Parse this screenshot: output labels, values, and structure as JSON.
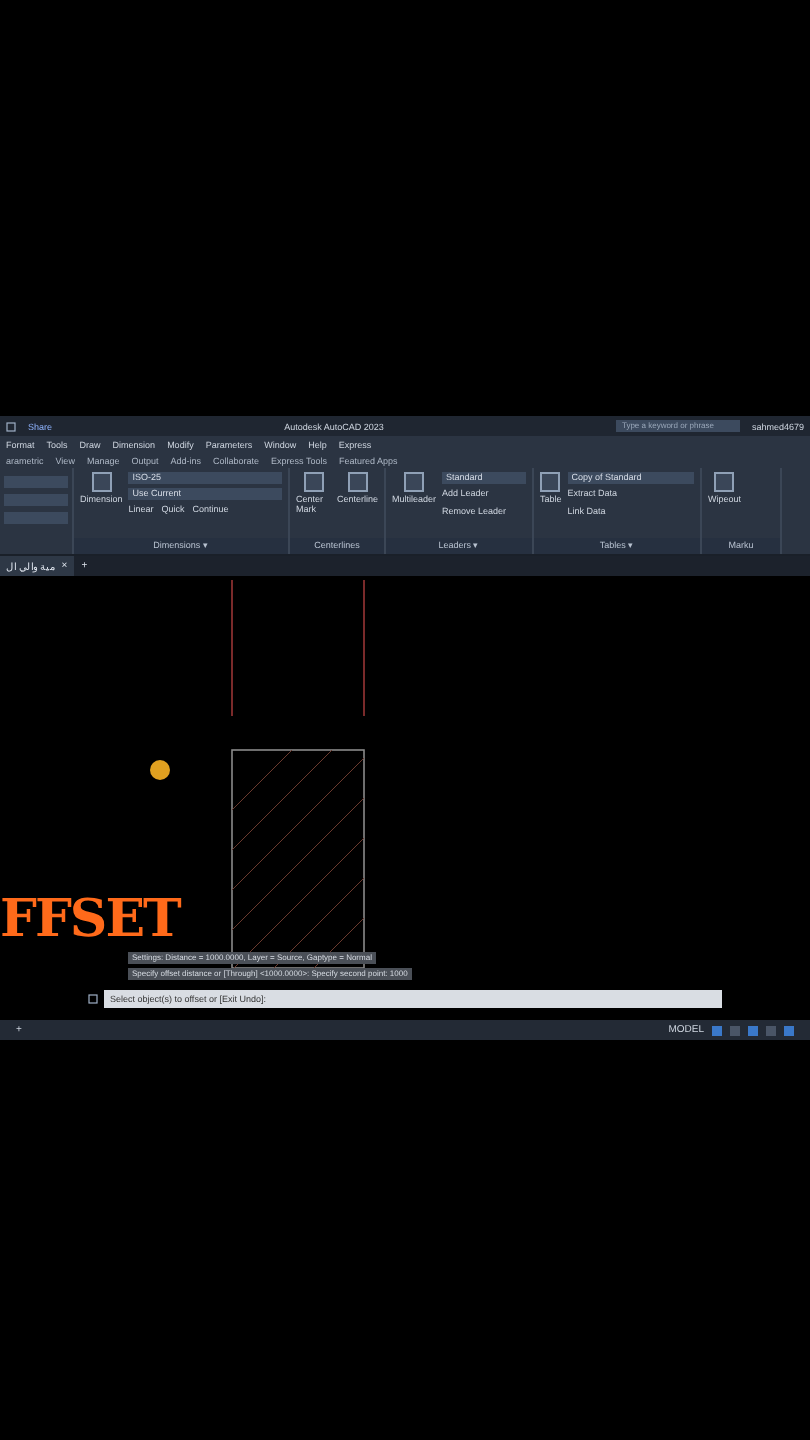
{
  "title_bar": {
    "share": "Share",
    "title": "Autodesk AutoCAD 2023",
    "search": {
      "placeholder": "Type a keyword or phrase"
    },
    "user": "sahmed4679"
  },
  "menu": [
    "Format",
    "Tools",
    "Draw",
    "Dimension",
    "Modify",
    "Parameters",
    "Window",
    "Help",
    "Express"
  ],
  "ribbon_tabs": [
    {
      "label": "arametric",
      "selected": false
    },
    {
      "label": "View",
      "selected": false
    },
    {
      "label": "Manage",
      "selected": false
    },
    {
      "label": "Output",
      "selected": false
    },
    {
      "label": "Add-ins",
      "selected": false
    },
    {
      "label": "Collaborate",
      "selected": false
    },
    {
      "label": "Express Tools",
      "selected": false
    },
    {
      "label": "Featured Apps",
      "selected": false
    }
  ],
  "panels": [
    {
      "kind": "dimensions",
      "title": "Dimensions ▾",
      "big": "Dimension",
      "style": "ISO-25",
      "layer": "Use Current",
      "tools": [
        "Linear",
        "Quick",
        "Continue"
      ]
    },
    {
      "kind": "centerlines",
      "title": "Centerlines",
      "tools": [
        "Center Mark",
        "Centerline"
      ]
    },
    {
      "kind": "leaders",
      "title": "Leaders ▾",
      "big": "Multileader",
      "style": "Standard",
      "tools": [
        "Add Leader",
        "Remove Leader"
      ]
    },
    {
      "kind": "tables",
      "title": "Tables ▾",
      "big": "Table",
      "style": "Copy of Standard",
      "tools": [
        "Extract Data",
        "Link Data"
      ]
    },
    {
      "kind": "markup",
      "title": "Marku",
      "big": "Wipeout"
    }
  ],
  "file_tab": {
    "label": "مية والي ال",
    "close": "×",
    "add": "+"
  },
  "overlay_caption": "FFSET",
  "command_history": [
    "Settings: Distance = 1000.0000, Layer = Source, Gaptype = Normal",
    "Specify offset distance or [Through] <1000.0000>: Specify second point: 1000"
  ],
  "command_prompt": "Select object(s) to offset or [Exit Undo]:",
  "status_bar": {
    "add": "+",
    "mode": "MODEL"
  }
}
